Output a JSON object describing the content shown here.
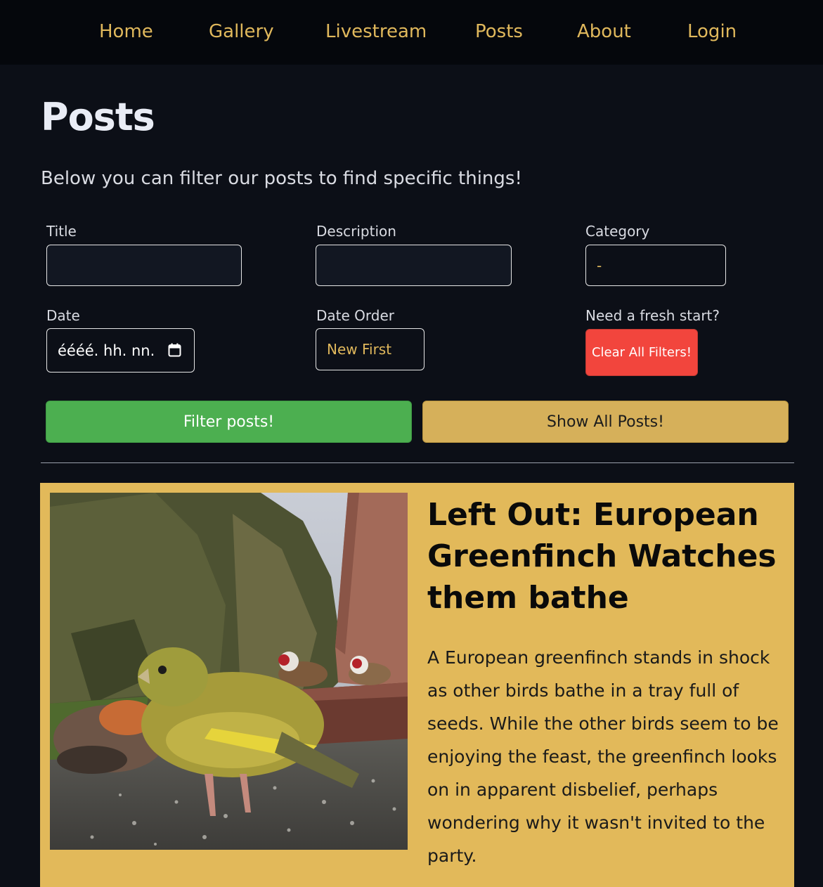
{
  "nav": {
    "items": [
      {
        "label": "Home"
      },
      {
        "label": "Gallery"
      },
      {
        "label": "Livestream"
      },
      {
        "label": "Posts"
      },
      {
        "label": "About"
      },
      {
        "label": "Login"
      }
    ]
  },
  "page": {
    "title": "Posts",
    "intro": "Below you can filter our posts to find specific things!"
  },
  "filters": {
    "title_label": "Title",
    "title_value": "",
    "description_label": "Description",
    "description_value": "",
    "category_label": "Category",
    "category_value": "-",
    "date_label": "Date",
    "date_placeholder": "éééé. hh. nn.",
    "date_order_label": "Date Order",
    "date_order_value": "New First",
    "fresh_label": "Need a fresh start?",
    "clear_button": "Clear All Filters!",
    "filter_button": "Filter posts!",
    "show_all_button": "Show All Posts!"
  },
  "post": {
    "title": "Left Out: European Greenfinch Watches them bathe",
    "description": "A European greenfinch stands in shock as other birds bathe in a tray full of seeds. While the other birds seem to be enjoying the feast, the greenfinch looks on in apparent disbelief, perhaps wondering why it wasn't invited to the party."
  },
  "colors": {
    "background": "#0c0f17",
    "navbar": "#05070c",
    "accent": "#e0b85c",
    "card": "#e2b95a",
    "filter_button": "#4caf50",
    "show_all_button": "#d6b05a",
    "clear_button": "#f2453d"
  },
  "icons": {
    "date_picker": "calendar-icon"
  }
}
